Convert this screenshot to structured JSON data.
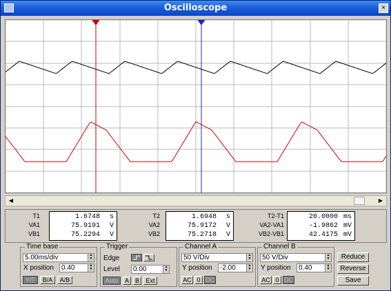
{
  "window": {
    "title": "Oscilloscope",
    "close_glyph": "×"
  },
  "cursors": {
    "t1_marker": "1",
    "t2_marker": "2"
  },
  "readouts": {
    "left": {
      "rows": [
        {
          "label": "T1",
          "value": "1.6748",
          "unit": "s"
        },
        {
          "label": "VA1",
          "value": "75.9191",
          "unit": "V"
        },
        {
          "label": "VB1",
          "value": "75.2294",
          "unit": "V"
        }
      ]
    },
    "mid": {
      "rows": [
        {
          "label": "T2",
          "value": "1.6948",
          "unit": "s"
        },
        {
          "label": "VA2",
          "value": "75.9172",
          "unit": "V"
        },
        {
          "label": "VB2",
          "value": "75.2718",
          "unit": "V"
        }
      ]
    },
    "right": {
      "rows": [
        {
          "label": "T2-T1",
          "value": "20.0000",
          "unit": "ms"
        },
        {
          "label": "VA2-VA1",
          "value": "-1.9862",
          "unit": "mV"
        },
        {
          "label": "VB2-VB1",
          "value": "42.4175",
          "unit": "mV"
        }
      ]
    }
  },
  "timebase": {
    "title": "Time base",
    "scale": "5.00ms/div",
    "xpos_label": "X position",
    "xpos": "0.40",
    "buttons": [
      "Y/T",
      "B/A",
      "A/B"
    ]
  },
  "trigger": {
    "title": "Trigger",
    "edge_label": "Edge",
    "level_label": "Level",
    "level": "0.00",
    "buttons": [
      "Auto",
      "A",
      "B",
      "Ext"
    ]
  },
  "channel_a": {
    "title": "Channel A",
    "scale": "50 V/Div",
    "ypos_label": "Y position",
    "ypos": "-2.00",
    "buttons": [
      "AC",
      "0",
      "DC"
    ]
  },
  "channel_b": {
    "title": "Channel B",
    "scale": "50 V/Div",
    "ypos_label": "Y position",
    "ypos": "0.40",
    "buttons": [
      "AC",
      "0",
      "DC"
    ]
  },
  "actions": {
    "reduce": "Reduce",
    "reverse": "Reverse",
    "save": "Save"
  },
  "icons": {
    "rising_edge": "rising-edge-icon",
    "falling_edge": "falling-edge-icon",
    "scroll_left": "scroll-left-icon",
    "scroll_right": "scroll-right-icon"
  },
  "colors": {
    "trace_a": "#000000",
    "trace_b": "#cc0000",
    "cursor1": "#cc0000",
    "cursor2": "#2222cc",
    "grid": "#b8b8b8"
  }
}
